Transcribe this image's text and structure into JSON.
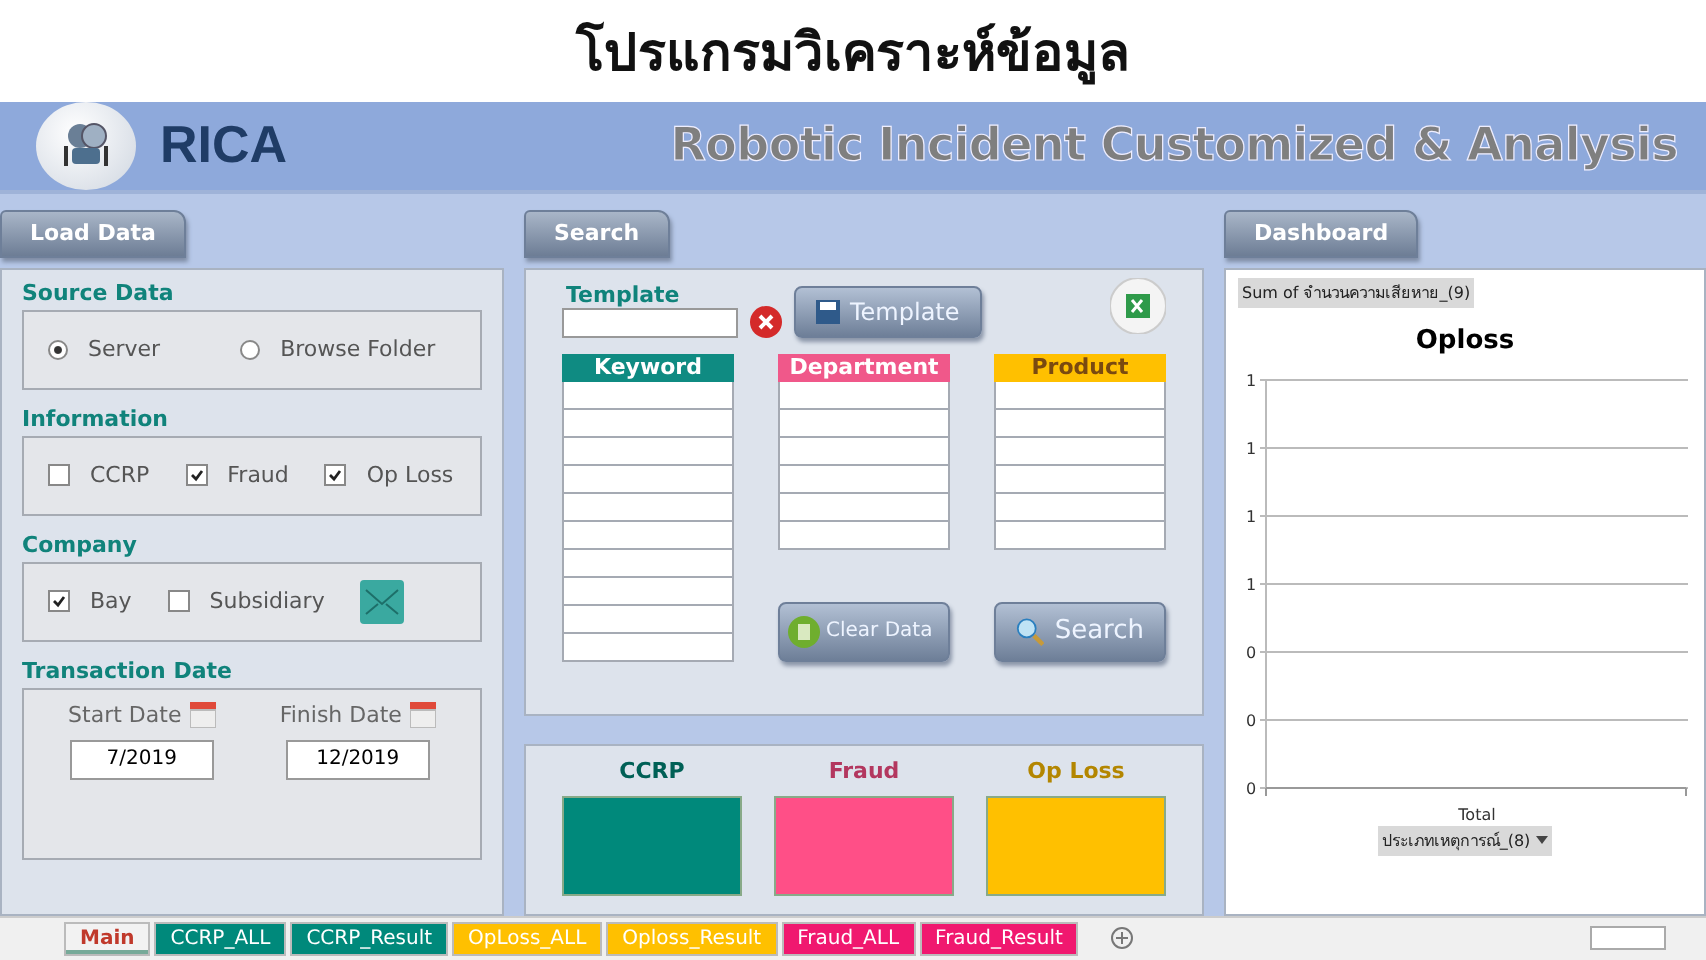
{
  "slide_title": "โปรแกรมวิเคราะห์ข้อมูล",
  "header": {
    "logo_text": "RICA",
    "title": "Robotic Incident Customized & Analysis"
  },
  "load_panel": {
    "button": "Load Data",
    "source_data": {
      "heading": "Source Data",
      "options": [
        {
          "label": "Server",
          "selected": true
        },
        {
          "label": "Browse Folder",
          "selected": false
        }
      ]
    },
    "information": {
      "heading": "Information",
      "options": [
        {
          "label": "CCRP",
          "checked": false
        },
        {
          "label": "Fraud",
          "checked": true
        },
        {
          "label": "Op Loss",
          "checked": true
        }
      ]
    },
    "company": {
      "heading": "Company",
      "options": [
        {
          "label": "Bay",
          "checked": true
        },
        {
          "label": "Subsidiary",
          "checked": false
        }
      ]
    },
    "transaction_date": {
      "heading": "Transaction Date",
      "fields": [
        {
          "label": "Start Date",
          "value": "7/2019"
        },
        {
          "label": "Finish Date",
          "value": "12/2019"
        }
      ]
    }
  },
  "search_panel": {
    "button": "Search",
    "template_label": "Template",
    "template_button": "Template",
    "lists": [
      {
        "header": "Keyword",
        "color": "#0f8b82",
        "kind": "tall"
      },
      {
        "header": "Department",
        "color": "#f0588a",
        "kind": "short"
      },
      {
        "header": "Product",
        "color": "#ffc000",
        "kind": "short"
      }
    ],
    "clear_button": "Clear Data",
    "search_button": "Search"
  },
  "summary": [
    {
      "label": "CCRP",
      "color": "#00897b"
    },
    {
      "label": "Fraud",
      "color": "#ff4f87"
    },
    {
      "label": "Op Loss",
      "color": "#ffc000"
    }
  ],
  "dashboard": {
    "button": "Dashboard",
    "filter_button": "ประเภทเหตุการณ์_(8)",
    "chart_data": {
      "type": "bar",
      "title": "Oploss",
      "categories": [
        "Total"
      ],
      "grid": true,
      "series": [
        {
          "name": "Sum of จำนวนความเสียหาย_(9)",
          "values": [
            null
          ]
        }
      ],
      "ylim": [
        0,
        1.2
      ],
      "yticks": [
        {
          "value": 0,
          "label": "0"
        },
        {
          "value": 0.2,
          "label": "0"
        },
        {
          "value": 0.4,
          "label": "0"
        },
        {
          "value": 0.6,
          "label": "1"
        },
        {
          "value": 0.8,
          "label": "1"
        },
        {
          "value": 1,
          "label": "1"
        },
        {
          "value": 1.2,
          "label": "1"
        }
      ]
    }
  },
  "sheet_tabs": [
    {
      "label": "Main",
      "selected": true,
      "color": "#f2f2f2"
    },
    {
      "label": "CCRP_ALL",
      "selected": false,
      "color": "#00897b"
    },
    {
      "label": "CCRP_Result",
      "selected": false,
      "color": "#00897b"
    },
    {
      "label": "OpLoss_ALL",
      "selected": false,
      "color": "#ffc000"
    },
    {
      "label": "Oploss_Result",
      "selected": false,
      "color": "#ffc000"
    },
    {
      "label": "Fraud_ALL",
      "selected": false,
      "color": "#f0186f"
    },
    {
      "label": "Fraud_Result",
      "selected": false,
      "color": "#f0186f"
    }
  ]
}
